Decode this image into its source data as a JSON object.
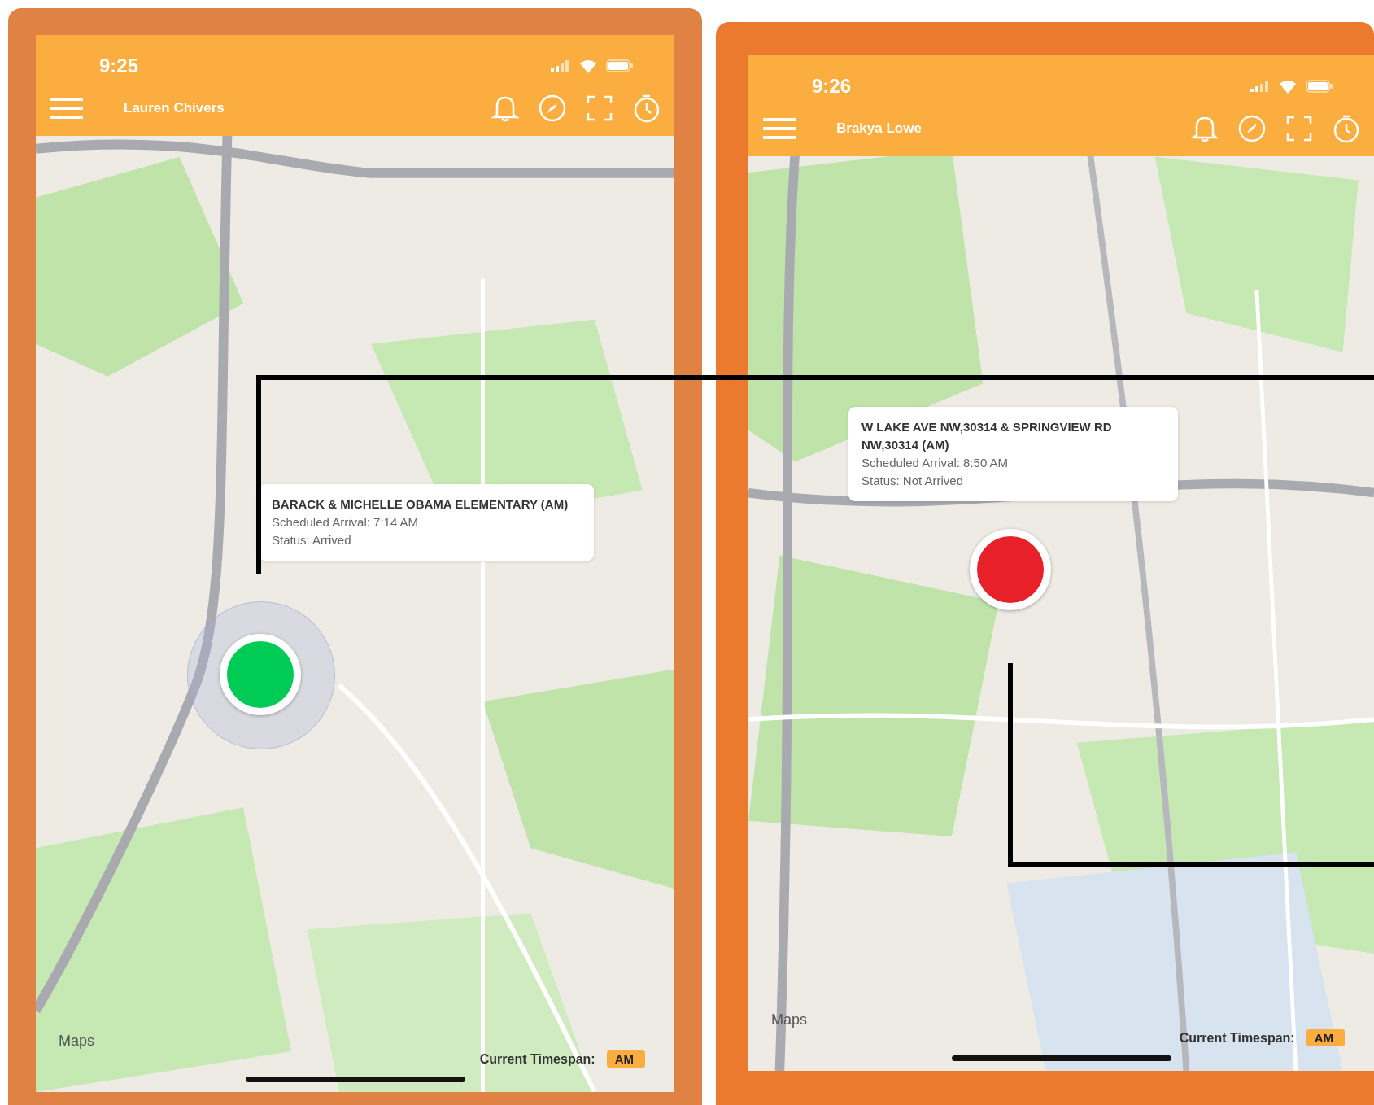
{
  "phones": [
    {
      "status_bar": {
        "time": "9:25"
      },
      "header": {
        "title": "Lauren Chivers"
      },
      "callout": {
        "title": "BARACK & MICHELLE OBAMA ELEMENTARY (AM)",
        "scheduled": "Scheduled Arrival: 7:14 AM",
        "status": "Status: Arrived"
      },
      "marker": {
        "color": "#00cc55"
      },
      "attribution": "Maps",
      "timespan": {
        "label": "Current Timespan:",
        "value": "AM"
      }
    },
    {
      "status_bar": {
        "time": "9:26"
      },
      "header": {
        "title": "Brakya Lowe"
      },
      "callout": {
        "title": "W LAKE AVE NW,30314 & SPRINGVIEW RD NW,30314 (AM)",
        "scheduled": "Scheduled Arrival: 8:50 AM",
        "status": "Status: Not Arrived"
      },
      "marker": {
        "color": "#e8202a"
      },
      "attribution": "Maps",
      "timespan": {
        "label": "Current Timespan:",
        "value": "AM"
      }
    }
  ]
}
